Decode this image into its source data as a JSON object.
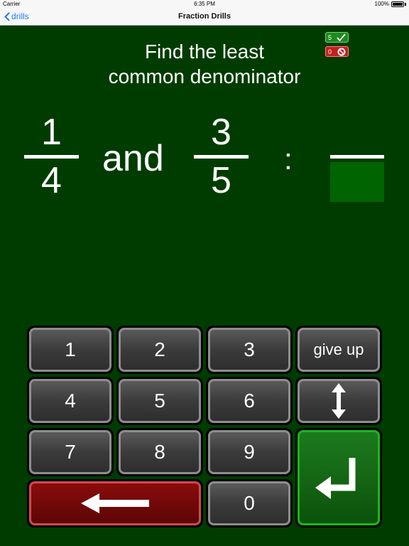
{
  "status_bar": {
    "carrier": "Carrier",
    "time": "6:35 PM",
    "battery": "100%"
  },
  "nav": {
    "back_label": "drills",
    "title": "Fraction Drills"
  },
  "prompt": {
    "line1": "Find the least",
    "line2": "common denominator"
  },
  "score": {
    "correct": "5",
    "wrong": "0"
  },
  "problem": {
    "fraction1": {
      "numerator": "1",
      "denominator": "4"
    },
    "connector": "and",
    "fraction2": {
      "numerator": "3",
      "denominator": "5"
    },
    "separator": ":"
  },
  "keypad": {
    "k1": "1",
    "k2": "2",
    "k3": "3",
    "give_up": "give up",
    "k4": "4",
    "k5": "5",
    "k6": "6",
    "k7": "7",
    "k8": "8",
    "k9": "9",
    "k0": "0"
  },
  "icons": {
    "back": "chevron-left-icon",
    "check": "checkmark-icon",
    "no": "prohibited-icon",
    "swap": "up-down-arrow-icon",
    "enter": "return-arrow-icon",
    "backspace": "left-arrow-icon"
  },
  "colors": {
    "background": "#003c00",
    "answer_box": "#006400",
    "enter_key": "#16b81a",
    "backspace_key": "#8a0c0c",
    "nav_tint": "#1a7cf5"
  }
}
